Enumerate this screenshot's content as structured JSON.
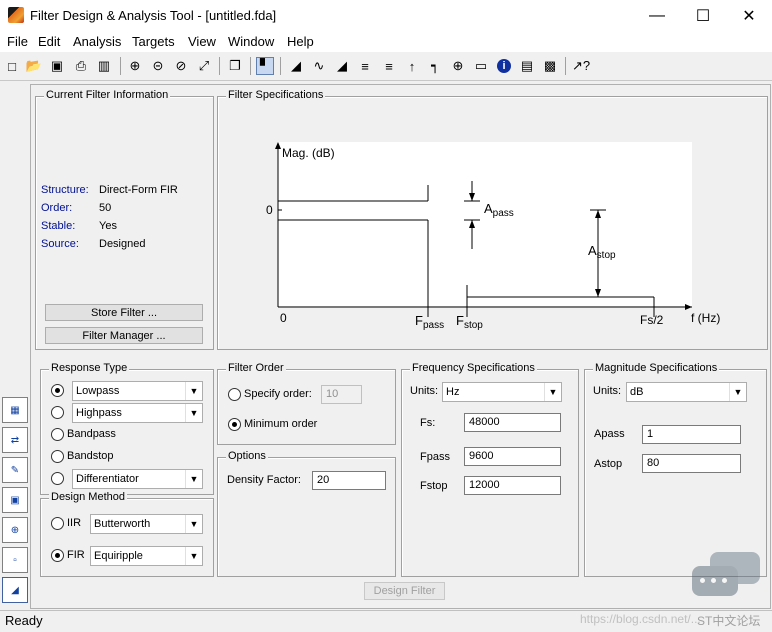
{
  "window": {
    "title": "Filter Design & Analysis Tool - [untitled.fda]"
  },
  "menu": [
    "File",
    "Edit",
    "Analysis",
    "Targets",
    "View",
    "Window",
    "Help"
  ],
  "current_filter": {
    "title": "Current Filter Information",
    "structure_label": "Structure:",
    "structure": "Direct-Form FIR",
    "order_label": "Order:",
    "order": "50",
    "stable_label": "Stable:",
    "stable": "Yes",
    "source_label": "Source:",
    "source": "Designed",
    "store_btn": "Store Filter ...",
    "manager_btn": "Filter Manager ..."
  },
  "spec": {
    "title": "Filter Specifications",
    "mag": "Mag. (dB)",
    "zero_y": "0",
    "zero_x": "0",
    "apass_a": "A",
    "apass_sub": "pass",
    "astop_a": "A",
    "astop_sub": "stop",
    "fpass_f": "F",
    "fpass_sub": "pass",
    "fstop_f": "F",
    "fstop_sub": "stop",
    "fs2": "Fs/2",
    "fhz": "f (Hz)"
  },
  "response": {
    "title": "Response Type",
    "lowpass": "Lowpass",
    "highpass": "Highpass",
    "bandpass": "Bandpass",
    "bandstop": "Bandstop",
    "diff": "Differentiator"
  },
  "design": {
    "title": "Design Method",
    "iir": "IIR",
    "iir_val": "Butterworth",
    "fir": "FIR",
    "fir_val": "Equiripple"
  },
  "order": {
    "title": "Filter Order",
    "specify": "Specify order:",
    "specify_val": "10",
    "minimum": "Minimum order"
  },
  "options": {
    "title": "Options",
    "density_label": "Density Factor:",
    "density": "20"
  },
  "freq": {
    "title": "Frequency Specifications",
    "units_label": "Units:",
    "units": "Hz",
    "fs_label": "Fs:",
    "fs": "48000",
    "fpass_label": "Fpass",
    "fpass": "9600",
    "fstop_label": "Fstop",
    "fstop": "12000"
  },
  "mag": {
    "title": "Magnitude Specifications",
    "units_label": "Units:",
    "units": "dB",
    "apass_label": "Apass",
    "apass": "1",
    "astop_label": "Astop",
    "astop": "80"
  },
  "design_btn": "Design Filter",
  "status": "Ready",
  "watermark": "https://blog.csdn.net/...",
  "watermark2": "ST中文论坛"
}
